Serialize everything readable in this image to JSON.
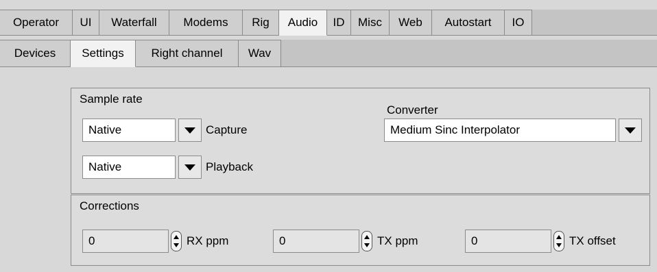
{
  "tabs": [
    "Operator",
    "UI",
    "Waterfall",
    "Modems",
    "Rig",
    "Audio",
    "ID",
    "Misc",
    "Web",
    "Autostart",
    "IO"
  ],
  "active_tab": "Audio",
  "subtabs": [
    "Devices",
    "Settings",
    "Right channel",
    "Wav"
  ],
  "active_subtab": "Settings",
  "sample_rate": {
    "title": "Sample rate",
    "capture_value": "Native",
    "capture_label": "Capture",
    "playback_value": "Native",
    "playback_label": "Playback",
    "converter_label": "Converter",
    "converter_value": "Medium Sinc Interpolator"
  },
  "corrections": {
    "title": "Corrections",
    "rx_value": "0",
    "rx_label": "RX ppm",
    "tx_value": "0",
    "tx_label": "TX ppm",
    "offset_value": "0",
    "offset_label": "TX offset"
  }
}
